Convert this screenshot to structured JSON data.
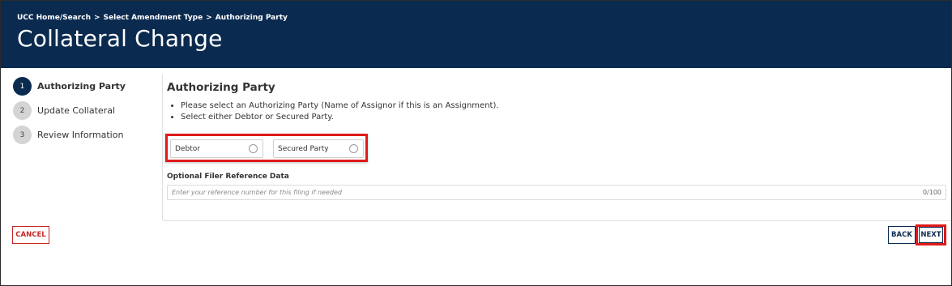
{
  "header": {
    "breadcrumbs": [
      "UCC Home/Search",
      "Select Amendment Type",
      "Authorizing Party"
    ],
    "separator": ">",
    "title": "Collateral Change"
  },
  "stepper": {
    "steps": [
      {
        "number": "1",
        "label": "Authorizing Party",
        "active": true
      },
      {
        "number": "2",
        "label": "Update Collateral",
        "active": false
      },
      {
        "number": "3",
        "label": "Review Information",
        "active": false
      }
    ]
  },
  "main": {
    "section_title": "Authorizing Party",
    "instructions": [
      "Please select an Authorizing Party (Name of Assignor if this is an Assignment).",
      "Select either Debtor or Secured Party."
    ],
    "party_options": [
      {
        "label": "Debtor",
        "selected": false
      },
      {
        "label": "Secured Party",
        "selected": false
      }
    ],
    "reference": {
      "label": "Optional Filer Reference Data",
      "value": "",
      "placeholder": "Enter your reference number for this filing if needed",
      "counter": "0/100"
    }
  },
  "footer": {
    "cancel_label": "CANCEL",
    "back_label": "BACK",
    "next_label": "NEXT"
  },
  "colors": {
    "header_bg": "#0b2a4f",
    "highlight": "#e01a1a",
    "cancel": "#c62828"
  }
}
